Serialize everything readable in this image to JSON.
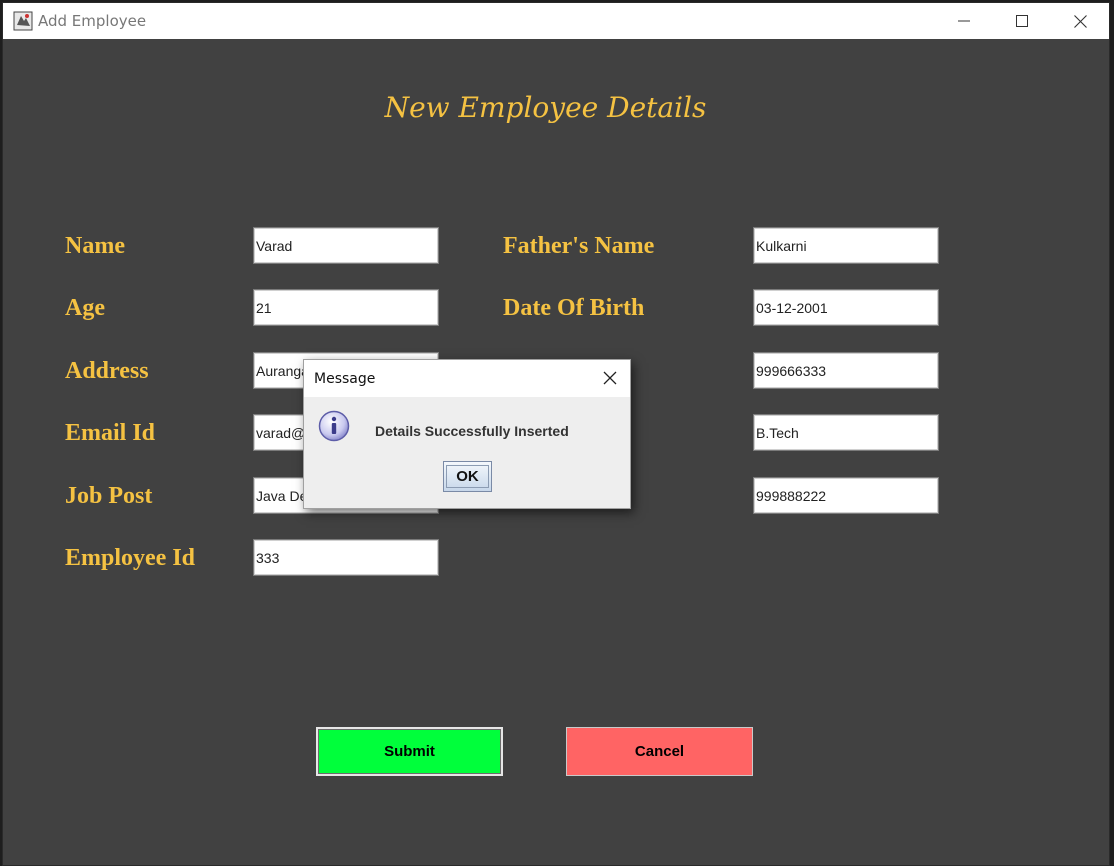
{
  "window": {
    "title": "Add Employee"
  },
  "form": {
    "heading": "New Employee Details",
    "labels": {
      "name": "Name",
      "age": "Age",
      "address": "Address",
      "email": "Email Id",
      "job_post": "Job Post",
      "employee_id": "Employee Id",
      "fathers_name": "Father's Name",
      "dob": "Date Of Birth"
    },
    "values": {
      "name": "Varad",
      "age": "21",
      "address": "Aurangabad",
      "email": "varad@",
      "job_post": "Java Developer",
      "employee_id": "333",
      "fathers_name": "Kulkarni",
      "dob": "03-12-2001",
      "phone": "999666333",
      "education": "B.Tech",
      "aadhar": "999888222"
    },
    "buttons": {
      "submit": "Submit",
      "cancel": "Cancel"
    },
    "colors": {
      "background": "#414141",
      "label": "#f5c242",
      "submit": "#00ff3b",
      "cancel": "#ff6464"
    }
  },
  "dialog": {
    "title": "Message",
    "message": "Details Successfully Inserted",
    "ok_label": "OK",
    "icon": "info-icon"
  }
}
